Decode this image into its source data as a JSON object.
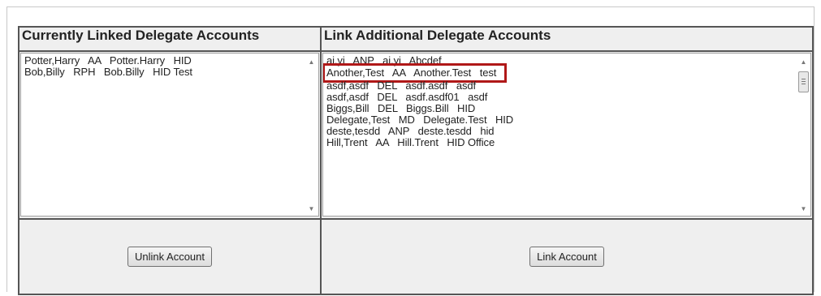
{
  "linked": {
    "header": "Currently Linked Delegate Accounts",
    "items": [
      "Potter,Harry   AA   Potter.Harry   HID",
      "Bob,Billy   RPH   Bob.Billy   HID Test"
    ],
    "button_label": "Unlink Account"
  },
  "additional": {
    "header": "Link Additional Delegate Accounts",
    "items": [
      "ai,yi   ANP   ai.yi   Abcdef",
      "Another,Test   AA   Another.Test   test",
      "asdf,asdf   DEL   asdf.asdf   asdf",
      "asdf,asdf   DEL   asdf.asdf01   asdf",
      "Biggs,Bill   DEL   Biggs.Bill   HID",
      "Delegate,Test   MD   Delegate.Test   HID",
      "deste,tesdd   ANP   deste.tesdd   hid",
      "Hill,Trent   AA   Hill.Trent   HID Office"
    ],
    "highlighted_index": 1,
    "highlight_color": "#b01818",
    "button_label": "Link Account"
  },
  "icons": {
    "scroll_up": "scroll-up-arrow-icon",
    "scroll_down": "scroll-down-arrow-icon",
    "scroll_thumb": "scroll-thumb-grip-icon"
  }
}
